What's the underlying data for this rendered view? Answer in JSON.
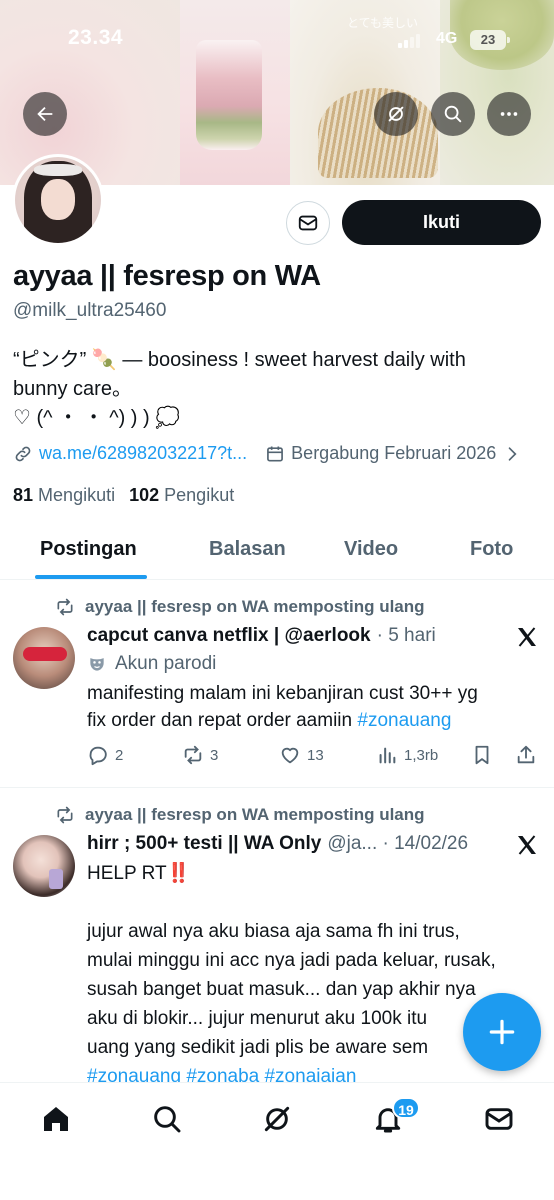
{
  "status_bar": {
    "time": "23.34",
    "network": "4G",
    "battery": "23"
  },
  "banner": {
    "overlay_text": "とても美しい"
  },
  "profile": {
    "name": "ayyaa || fesresp on WA",
    "handle": "@milk_ultra25460",
    "bio_lines": [
      "“ピンク” 🍡 — boosiness ! sweet harvest daily with",
      "bunny care。",
      "♡ (^ ・ ・ ^) ) ) 💭"
    ],
    "link": "wa.me/628982032217?t...",
    "joined": "Bergabung Februari 2026",
    "following_count": "81",
    "following_label": "Mengikuti",
    "followers_count": "102",
    "followers_label": "Pengikut",
    "follow_button": "Ikuti"
  },
  "tabs": [
    "Postingan",
    "Balasan",
    "Video",
    "Foto"
  ],
  "posts": [
    {
      "repost_label": "ayyaa || fesresp on WA memposting ulang",
      "author": "capcut canva netflix | @aerlook",
      "meta": "· 5 hari",
      "parody_label": "Akun parodi",
      "text_lines": [
        {
          "plain": "manifesting malam ini kebanjiran cust 30++ yg"
        },
        {
          "plain": "fix order dan repat order aamiin ",
          "hashtag": "#zonauang"
        }
      ],
      "replies": "2",
      "reposts": "3",
      "likes": "13",
      "views": "1,3rb"
    },
    {
      "repost_label": "ayyaa || fesresp on WA memposting ulang",
      "author": "hirr ; 500+ testi || WA Only",
      "meta": "@ja... · 14/02/26",
      "text_lines": [
        {
          "plain": "HELP RT‼️"
        },
        {
          "plain": ""
        },
        {
          "plain": "jujur awal nya aku biasa aja sama fh ini trus,"
        },
        {
          "plain": "mulai minggu ini acc nya jadi pada keluar, rusak,"
        },
        {
          "plain": "susah banget buat masuk... dan yap akhir nya"
        },
        {
          "plain": "aku di blokir... jujur menurut aku 100k itu"
        },
        {
          "plain": "uang yang sedikit jadi plis be aware sem"
        },
        {
          "hashtag": "#zonauang #zonaba #zonajajan"
        }
      ]
    }
  ],
  "notifications_badge": "19",
  "icons": [
    "back-icon",
    "grok-icon",
    "search-icon",
    "more-icon",
    "message-icon",
    "link-icon",
    "calendar-icon",
    "chevron-right-icon",
    "repost-icon",
    "x-logo-icon",
    "parody-mask-icon",
    "reply-icon",
    "like-icon",
    "views-icon",
    "bookmark-icon",
    "share-icon",
    "plus-icon",
    "home-icon",
    "bell-icon",
    "mail-icon"
  ],
  "colors": {
    "accent": "#1d9bf0",
    "text": "#0f1419",
    "secondary": "#536471",
    "follow_button": "#0f1419"
  }
}
